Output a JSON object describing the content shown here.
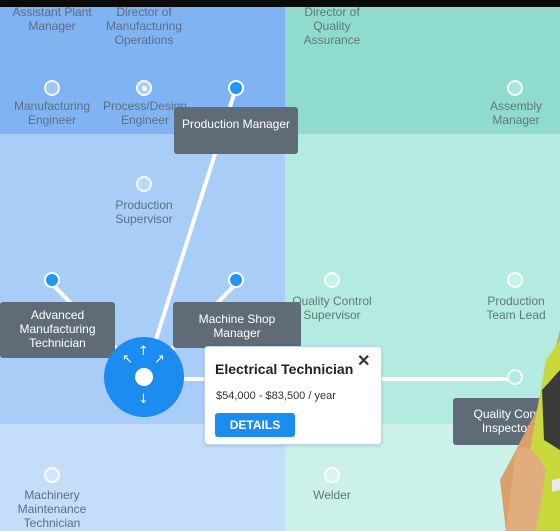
{
  "labels": {
    "assistant_plant_manager": "Assistant Plant Manager",
    "director_manufacturing": "Director of Manufacturing Operations",
    "director_quality": "Director of Quality Assurance",
    "manufacturing_engineer": "Manufacturing Engineer",
    "process_design_engineer": "Process/Design Engineer",
    "assembly_manager": "Assembly Manager",
    "production_supervisor": "Production Supervisor",
    "quality_control_supervisor": "Quality Control Supervisor",
    "production_team_lead": "Production Team Lead",
    "machinery_maintenance_technician": "Machinery Maintenance Technician",
    "welder": "Welder"
  },
  "tooltips": {
    "production_manager": "Production Manager",
    "advanced_manufacturing_technician": "Advanced Manufacturing Technician",
    "machine_shop_manager": "Machine Shop Manager",
    "quality_control_inspector": "Quality Cont Inspector"
  },
  "center_node": {
    "arrows": {
      "up": "↑",
      "down": "↓",
      "up_left": "↖",
      "up_right": "↗"
    }
  },
  "details_card": {
    "title": "Electrical Technician",
    "salary": "$54,000 - $83,500 / year",
    "button_label": "DETAILS",
    "close_glyph": "✕"
  },
  "colors": {
    "accent": "#1d8cf0",
    "tooltip_bg": "#5f6c78",
    "band_left": "#a8cdf6",
    "band_right": "#b4ebe0"
  },
  "icons": [
    "close-icon",
    "arrow-up-icon",
    "arrow-down-icon",
    "arrow-up-left-icon",
    "arrow-up-right-icon"
  ]
}
